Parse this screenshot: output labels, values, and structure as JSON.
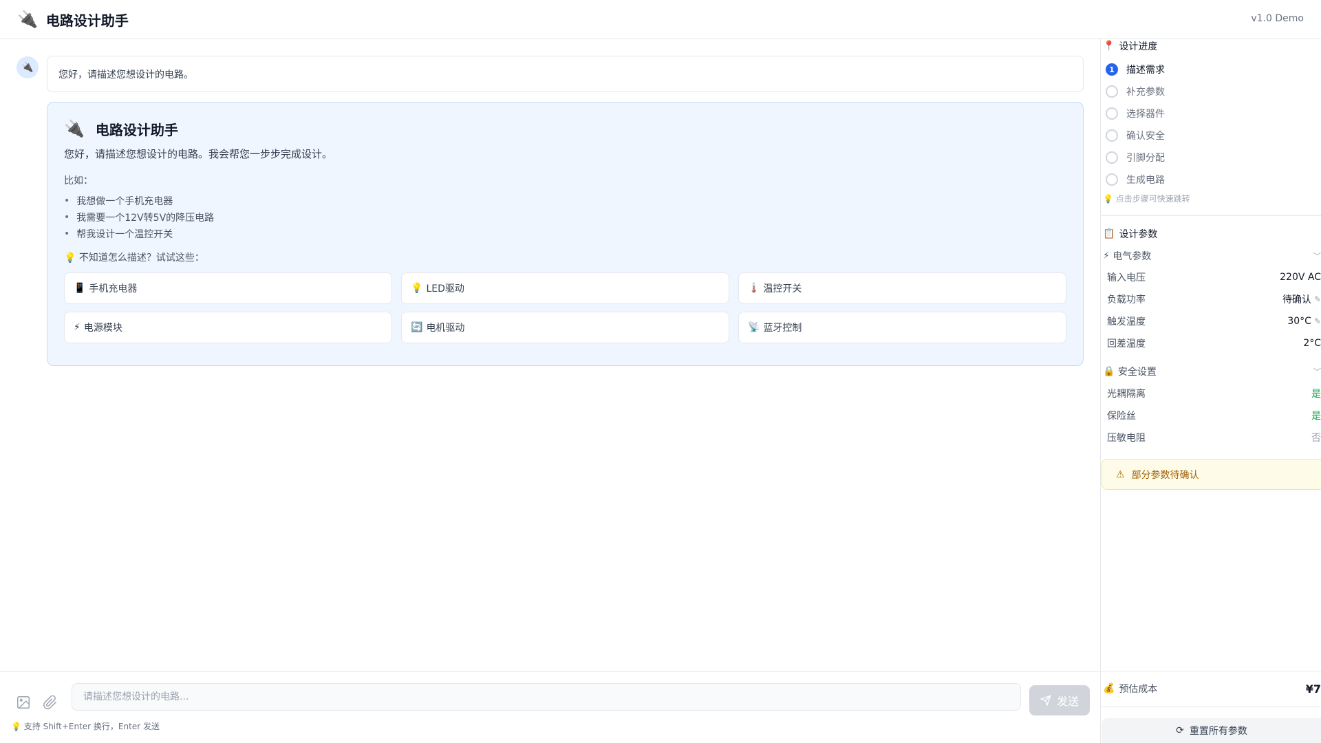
{
  "header": {
    "title": "电路设计助手",
    "version": "v1.0 Demo",
    "logo_icon": "🔌"
  },
  "chat": {
    "greeting": "您好，请描述您想设计的电路。",
    "card": {
      "title": "电路设计助手",
      "intro": "您好，请描述您想设计的电路。我会帮您一步步完成设计。",
      "examples_label": "比如：",
      "examples": [
        "我想做一个手机充电器",
        "我需要一个12V转5V的降压电路",
        "帮我设计一个温控开关"
      ],
      "tip": "💡 不知道怎么描述？试试这些：",
      "quick": [
        {
          "icon": "📱",
          "label": "手机充电器"
        },
        {
          "icon": "💡",
          "label": "LED驱动"
        },
        {
          "icon": "🌡️",
          "label": "温控开关"
        },
        {
          "icon": "⚡",
          "label": "电源模块"
        },
        {
          "icon": "🔄",
          "label": "电机驱动"
        },
        {
          "icon": "📡",
          "label": "蓝牙控制"
        }
      ]
    }
  },
  "composer": {
    "placeholder": "请描述您想设计的电路...",
    "send": "发送",
    "hint": "💡 支持 Shift+Enter 换行，Enter 发送"
  },
  "sidebar": {
    "progress_title": "设计进度",
    "steps": [
      "描述需求",
      "补充参数",
      "选择器件",
      "确认安全",
      "引脚分配",
      "生成电路"
    ],
    "active_step": 1,
    "step_tip": "点击步骤可快速跳转",
    "params_title": "设计参数",
    "electrical": {
      "title": "电气参数",
      "rows": [
        {
          "label": "输入电压",
          "value": "220V AC"
        },
        {
          "label": "负载功率",
          "value": "待确认"
        },
        {
          "label": "触发温度",
          "value": "30°C"
        },
        {
          "label": "回差温度",
          "value": "2°C"
        }
      ]
    },
    "safety": {
      "title": "安全设置",
      "rows": [
        {
          "label": "光耦隔离",
          "value": "是"
        },
        {
          "label": "保险丝",
          "value": "是"
        },
        {
          "label": "压敏电阻",
          "value": "否"
        }
      ]
    },
    "warning": "部分参数待确认",
    "cost_label": "预估成本",
    "cost_value": "¥7",
    "reset": "重置所有参数"
  },
  "colors": {
    "accent": "#2563eb",
    "card_bg": "#eff6ff",
    "yes": "#16a34a",
    "warn_text": "#a16207"
  }
}
